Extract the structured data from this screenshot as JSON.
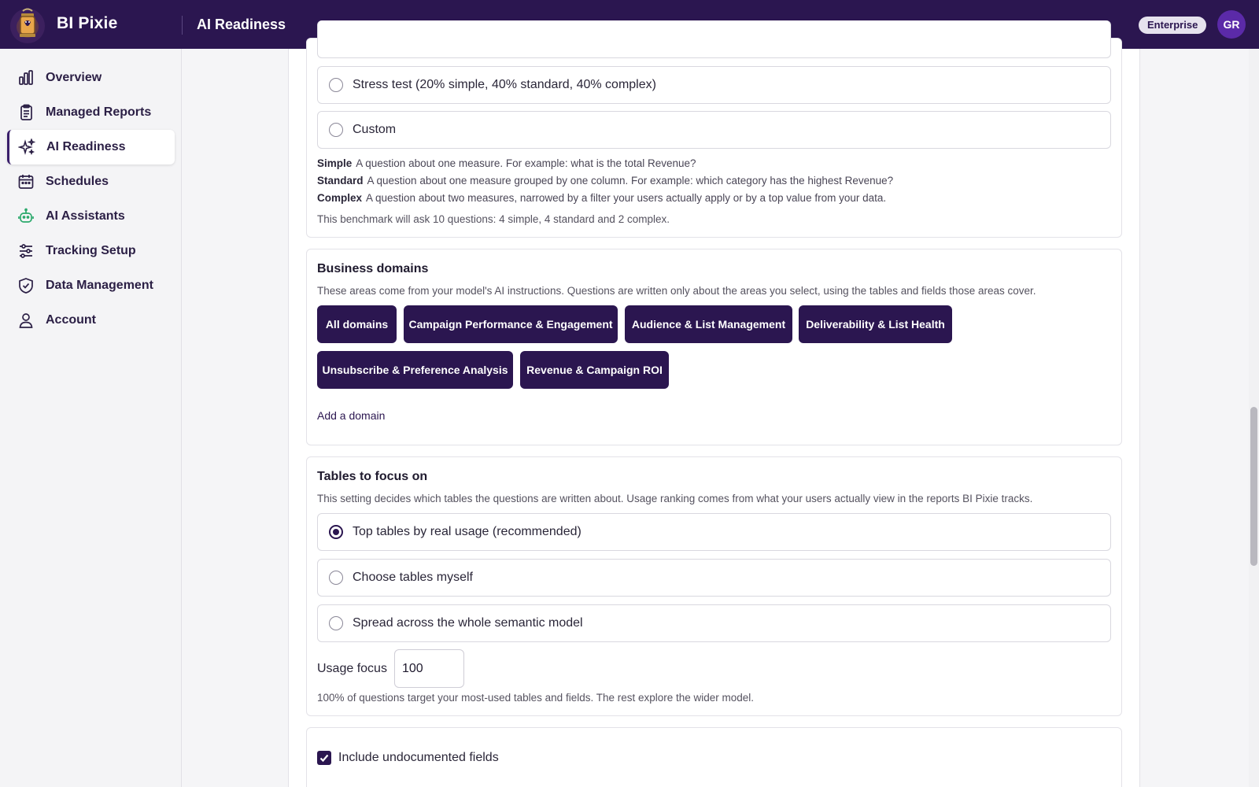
{
  "header": {
    "brand": "BI Pixie",
    "page_title": "AI Readiness",
    "plan_badge": "Enterprise",
    "avatar_initials": "GR"
  },
  "sidebar": {
    "active": "AI Readiness",
    "items": [
      {
        "label": "Overview",
        "icon": "bar-chart-icon"
      },
      {
        "label": "Managed Reports",
        "icon": "clipboard-icon"
      },
      {
        "label": "AI Readiness",
        "icon": "sparkles-icon"
      },
      {
        "label": "Schedules",
        "icon": "calendar-icon"
      },
      {
        "label": "AI Assistants",
        "icon": "robot-icon"
      },
      {
        "label": "Tracking Setup",
        "icon": "sliders-icon"
      },
      {
        "label": "Data Management",
        "icon": "shield-icon"
      },
      {
        "label": "Account",
        "icon": "user-icon"
      }
    ]
  },
  "mix": {
    "options": [
      {
        "label": "Stress test (20% simple, 40% standard, 40% complex)",
        "selected": false
      },
      {
        "label": "Custom",
        "selected": false
      }
    ],
    "definitions": [
      {
        "term": "Simple",
        "text": "A question about one measure. For example: what is the total Revenue?"
      },
      {
        "term": "Standard",
        "text": "A question about one measure grouped by one column. For example: which category has the highest Revenue?"
      },
      {
        "term": "Complex",
        "text": "A question about two measures, narrowed by a filter your users actually apply or by a top value from your data."
      }
    ],
    "summary": "This benchmark will ask 10 questions: 4 simple, 4 standard and 2 complex."
  },
  "domains": {
    "title": "Business domains",
    "description": "These areas come from your model's AI instructions. Questions are written only about the areas you select, using the tables and fields those areas cover.",
    "chips": [
      "All domains",
      "Campaign Performance & Engagement",
      "Audience & List Management",
      "Deliverability & List Health",
      "Unsubscribe & Preference Analysis",
      "Revenue & Campaign ROI"
    ],
    "add_link": "Add a domain"
  },
  "tables": {
    "title": "Tables to focus on",
    "description": "This setting decides which tables the questions are written about. Usage ranking comes from what your users actually view in the reports BI Pixie tracks.",
    "options": [
      {
        "label": "Top tables by real usage (recommended)",
        "selected": true
      },
      {
        "label": "Choose tables myself",
        "selected": false
      },
      {
        "label": "Spread across the whole semantic model",
        "selected": false
      }
    ],
    "usage_focus_label": "Usage focus",
    "usage_focus_value": "100",
    "usage_note": "100% of questions target your most-used tables and fields. The rest explore the wider model."
  },
  "fields": {
    "include_undocumented_label": "Include undocumented fields",
    "include_undocumented_checked": true
  },
  "colors": {
    "header_bg": "#2b1650",
    "accent": "#2b1650",
    "avatar_bg": "#5b2aa8",
    "assistant_icon": "#2aa86b"
  }
}
